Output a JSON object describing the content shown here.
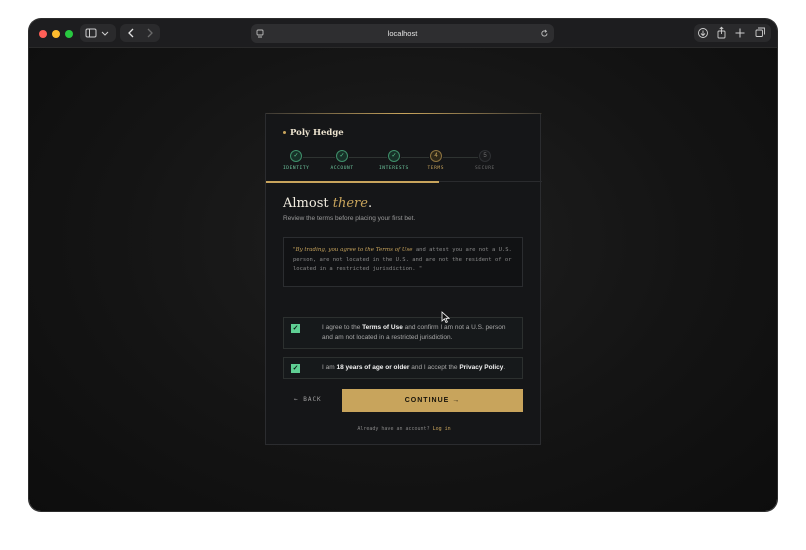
{
  "browser": {
    "address": "localhost",
    "colors": {
      "close": "#ff5f57",
      "minimize": "#febc2e",
      "maximize": "#28c840"
    }
  },
  "brand": {
    "name": "Poly Hedge",
    "accent": "#c8a45c"
  },
  "steps": [
    {
      "label": "IDENTITY",
      "state": "done",
      "marker": "✓"
    },
    {
      "label": "ACCOUNT",
      "state": "done",
      "marker": "✓"
    },
    {
      "label": "INTERESTS",
      "state": "done",
      "marker": "✓"
    },
    {
      "label": "TERMS",
      "state": "current",
      "marker": "4"
    },
    {
      "label": "SECURE",
      "state": "upcoming",
      "marker": "5"
    }
  ],
  "progress": {
    "fraction": 0.625
  },
  "heading": {
    "lead": "Almost ",
    "emphasis": "there",
    "trail": "."
  },
  "subheading": "Review the terms before placing your first bet.",
  "terms_quote": {
    "emphasis": "\"By trading, you agree to the Terms of Use",
    "rest": " and attest you are not a U.S. person, are not located in the U.S. and are not the resident of or located in a restricted jurisdiction. \""
  },
  "checks": [
    {
      "checked": true,
      "parts": [
        "I agree to the ",
        "Terms of Use",
        " and confirm I am not a U.S. person and am not located in a restricted jurisdiction."
      ]
    },
    {
      "checked": true,
      "parts": [
        "I am ",
        "18 years of age or older",
        " and I accept the ",
        "Privacy Policy",
        "."
      ]
    }
  ],
  "actions": {
    "back": "← BACK",
    "continue": "CONTINUE →"
  },
  "footer": {
    "prompt": "Already have an account? ",
    "link": "Log in"
  }
}
